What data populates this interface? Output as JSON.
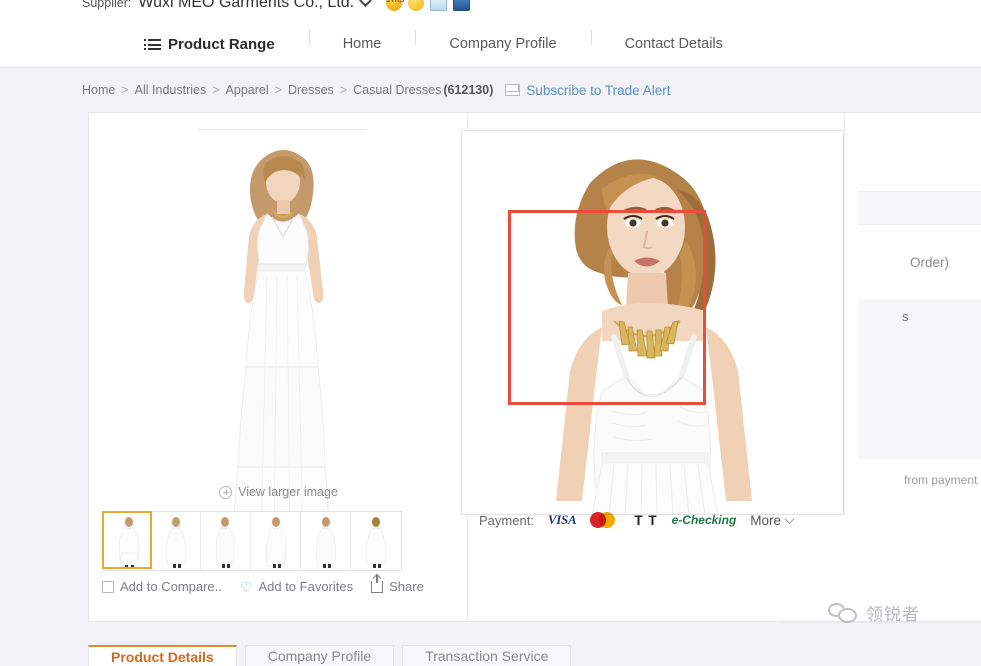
{
  "supplier": {
    "label": "Supplier:",
    "name": "Wuxi MEO Garments Co., Ltd.",
    "dropdown_icon": "chevron-down-icon",
    "badges": [
      {
        "name": "gold-supplier-badge",
        "text": "3YRS"
      },
      {
        "name": "assessed-supplier-badge",
        "text": ""
      },
      {
        "name": "onsite-check-badge",
        "text": ""
      },
      {
        "name": "trade-assurance-badge",
        "text": ""
      }
    ]
  },
  "nav": {
    "primary": {
      "label": "Product Range",
      "icon": "list-icon"
    },
    "items": [
      {
        "label": "Home"
      },
      {
        "label": "Company Profile"
      },
      {
        "label": "Contact Details"
      }
    ]
  },
  "breadcrumb": {
    "items": [
      "Home",
      "All Industries",
      "Apparel",
      "Dresses",
      "Casual Dresses"
    ],
    "separator": ">",
    "count": "(612130)",
    "alert_icon": "envelope-icon",
    "alert_label": "Subscribe to Trade Alert"
  },
  "gallery": {
    "view_larger_label": "View larger image",
    "view_larger_icon": "magnifier-plus-icon",
    "thumbnail_count": 6,
    "active_thumbnail_index": 0,
    "selected_border_color": "#e8a833"
  },
  "actions": {
    "compare": {
      "label": "Add to Compare..",
      "icon": "checkbox-icon"
    },
    "favorites": {
      "label": "Add to Favorites",
      "icon": "heart-icon"
    },
    "share": {
      "label": "Share",
      "icon": "share-icon"
    }
  },
  "detection": {
    "box_color": "#ec4b3c",
    "box_label": ""
  },
  "payment": {
    "label": "Payment:",
    "methods": [
      {
        "name": "visa-logo",
        "text": "VISA"
      },
      {
        "name": "mastercard-logo",
        "text": ""
      },
      {
        "name": "tt-logo",
        "text": "T T"
      },
      {
        "name": "echecking-logo",
        "text": "e-Checking"
      }
    ],
    "more_label": "More",
    "more_icon": "chevron-down-icon"
  },
  "right_panel": {
    "order_fragment": "Order)",
    "s_fragment": "s",
    "delivery_fragment": "from payment to delivery"
  },
  "tabs": [
    {
      "label": "Product Details",
      "active": true
    },
    {
      "label": "Company Profile",
      "active": false
    },
    {
      "label": "Transaction Service",
      "active": false
    }
  ],
  "watermark": {
    "text": "领锐者",
    "icon": "wechat-bubbles-icon"
  }
}
